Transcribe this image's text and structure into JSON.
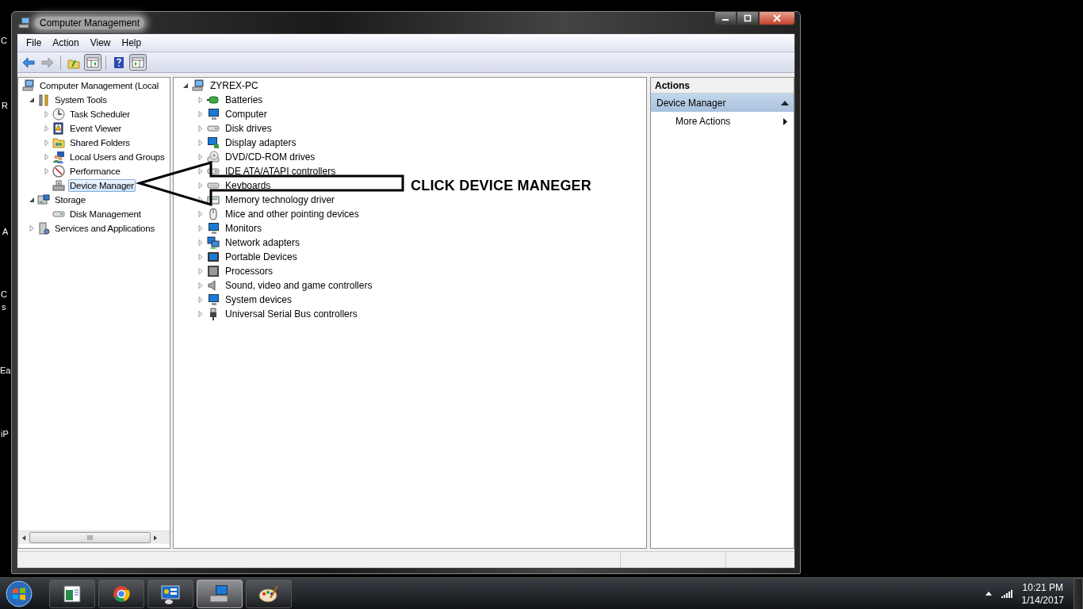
{
  "desktop": {
    "icon_labels": [
      {
        "text": "C"
      },
      {
        "text": "R"
      },
      {
        "text": "A"
      },
      {
        "text": "C"
      },
      {
        "text": "s"
      },
      {
        "text": "Ea"
      },
      {
        "text": "iP"
      }
    ]
  },
  "window": {
    "title": "Computer Management"
  },
  "menu": [
    {
      "label": "File"
    },
    {
      "label": "Action"
    },
    {
      "label": "View"
    },
    {
      "label": "Help"
    }
  ],
  "toolbar": [
    {
      "kind": "back",
      "pressed": false,
      "disabled": false
    },
    {
      "kind": "forward",
      "pressed": false,
      "disabled": true
    },
    {
      "kind": "up",
      "pressed": false,
      "disabled": false
    },
    {
      "kind": "tree",
      "pressed": true,
      "disabled": false
    },
    {
      "kind": "help",
      "pressed": false,
      "disabled": false
    },
    {
      "kind": "actionpane",
      "pressed": true,
      "disabled": false
    }
  ],
  "nav_tree": [
    {
      "label": "Computer Management (Local",
      "selected": false,
      "children": [
        {
          "label": "System Tools",
          "expanded": true,
          "selected": false,
          "children": [
            {
              "label": "Task Scheduler",
              "expanded": false,
              "selected": false
            },
            {
              "label": "Event Viewer",
              "expanded": false,
              "selected": false
            },
            {
              "label": "Shared Folders",
              "expanded": false,
              "selected": false
            },
            {
              "label": "Local Users and Groups",
              "expanded": false,
              "selected": false
            },
            {
              "label": "Performance",
              "expanded": false,
              "selected": false
            },
            {
              "label": "Device Manager",
              "selected": true
            }
          ]
        },
        {
          "label": "Storage",
          "expanded": true,
          "selected": false,
          "children": [
            {
              "label": "Disk Management",
              "selected": false
            }
          ]
        },
        {
          "label": "Services and Applications",
          "expanded": false,
          "selected": false
        }
      ]
    }
  ],
  "device_tree": [
    {
      "label": "ZYREX-PC",
      "expanded": true,
      "children": [
        {
          "label": "Batteries",
          "expanded": false
        },
        {
          "label": "Computer",
          "expanded": false
        },
        {
          "label": "Disk drives",
          "expanded": false
        },
        {
          "label": "Display adapters",
          "expanded": false
        },
        {
          "label": "DVD/CD-ROM drives",
          "expanded": false
        },
        {
          "label": "IDE ATA/ATAPI controllers",
          "expanded": false
        },
        {
          "label": "Keyboards",
          "expanded": false
        },
        {
          "label": "Memory technology driver",
          "expanded": false
        },
        {
          "label": "Mice and other pointing devices",
          "expanded": false
        },
        {
          "label": "Monitors",
          "expanded": false
        },
        {
          "label": "Network adapters",
          "expanded": false
        },
        {
          "label": "Portable Devices",
          "expanded": false
        },
        {
          "label": "Processors",
          "expanded": false
        },
        {
          "label": "Sound, video and game controllers",
          "expanded": false
        },
        {
          "label": "System devices",
          "expanded": false
        },
        {
          "label": "Universal Serial Bus controllers",
          "expanded": false
        }
      ]
    }
  ],
  "actions": {
    "title": "Actions",
    "section": {
      "label": "Device Manager",
      "expanded": true
    },
    "items": [
      {
        "label": "More Actions"
      }
    ]
  },
  "annotation": {
    "text": "CLICK DEVICE MANEGER"
  },
  "taskbar": {
    "apps": [
      {
        "selected": false
      },
      {
        "selected": false
      },
      {
        "selected": false
      },
      {
        "selected": true
      },
      {
        "selected": false
      }
    ],
    "time": "10:21 PM",
    "date": "1/14/2017"
  }
}
